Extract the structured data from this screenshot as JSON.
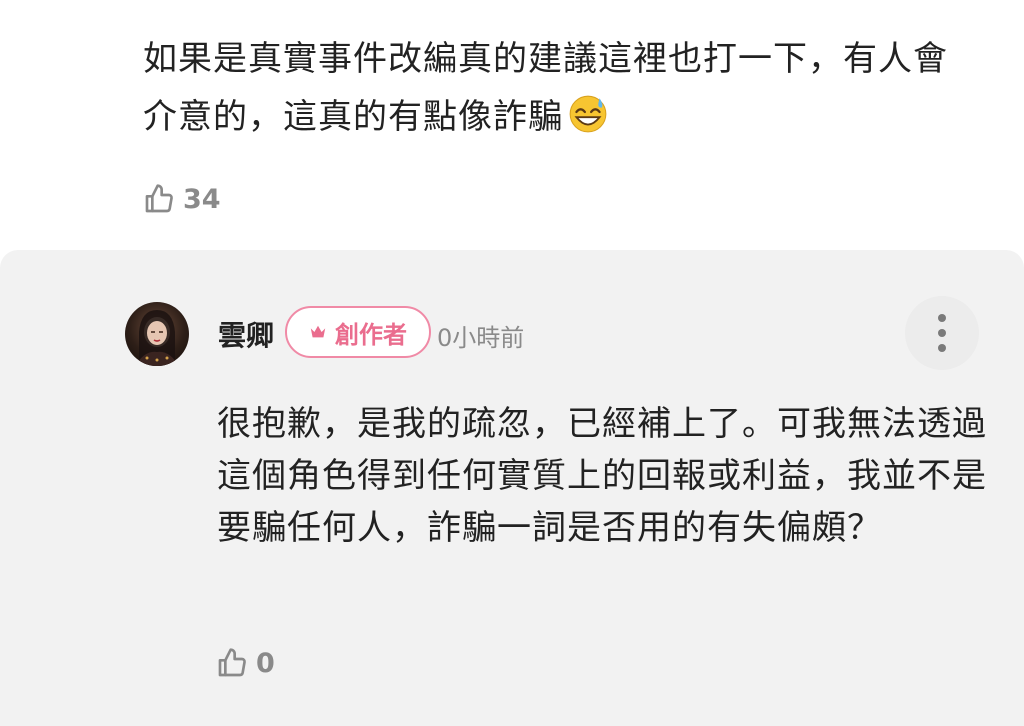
{
  "top_comment": {
    "text": "如果是真實事件改編真的建議這裡也打一下，有人會介意的，這真的有點像詐騙",
    "emoji": "grinning-sweat-face",
    "likes": "34"
  },
  "reply": {
    "author": "雲卿",
    "badge_label": "創作者",
    "timestamp": "0小時前",
    "text": "很抱歉，是我的疏忽，已經補上了。可我無法透過這個角色得到任何實質上的回報或利益，我並不是要騙任何人，詐騙一詞是否用的有失偏頗？",
    "likes": "0"
  },
  "colors": {
    "accent_pink": "#ea6d8e",
    "card_background": "#f2f2f2",
    "muted_text": "#8a8a8a"
  }
}
